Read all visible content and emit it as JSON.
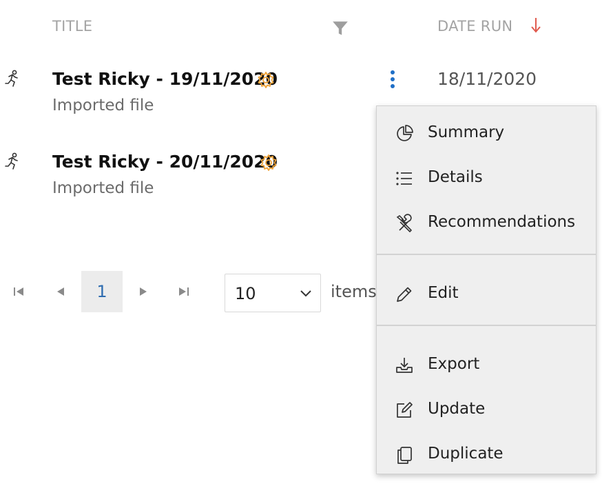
{
  "header": {
    "title_col": "TITLE",
    "date_col": "DATE RUN",
    "filter_icon": "filter-icon",
    "sort_icon": "arrow-down-icon",
    "sort_color": "#e05a4e"
  },
  "rows": [
    {
      "title": "Test Ricky - 19/11/2020",
      "subtitle": "Imported file",
      "date": "18/11/2020"
    },
    {
      "title": "Test Ricky - 20/11/2020",
      "subtitle": "Imported file",
      "date": ""
    }
  ],
  "colors": {
    "gear": "#f0a43a",
    "kebab": "#1f6fc7",
    "page_current": "#2e6cb0"
  },
  "pager": {
    "current_page": "1",
    "page_size": "10",
    "items_label": "items"
  },
  "menu": {
    "items": [
      {
        "label": "Summary",
        "icon": "pie-chart-icon"
      },
      {
        "label": "Details",
        "icon": "list-icon"
      },
      {
        "label": "Recommendations",
        "icon": "tools-icon"
      },
      {
        "label": "Edit",
        "icon": "pencil-icon"
      },
      {
        "label": "Export",
        "icon": "export-icon"
      },
      {
        "label": "Update",
        "icon": "edit-box-icon"
      },
      {
        "label": "Duplicate",
        "icon": "duplicate-icon"
      }
    ]
  }
}
